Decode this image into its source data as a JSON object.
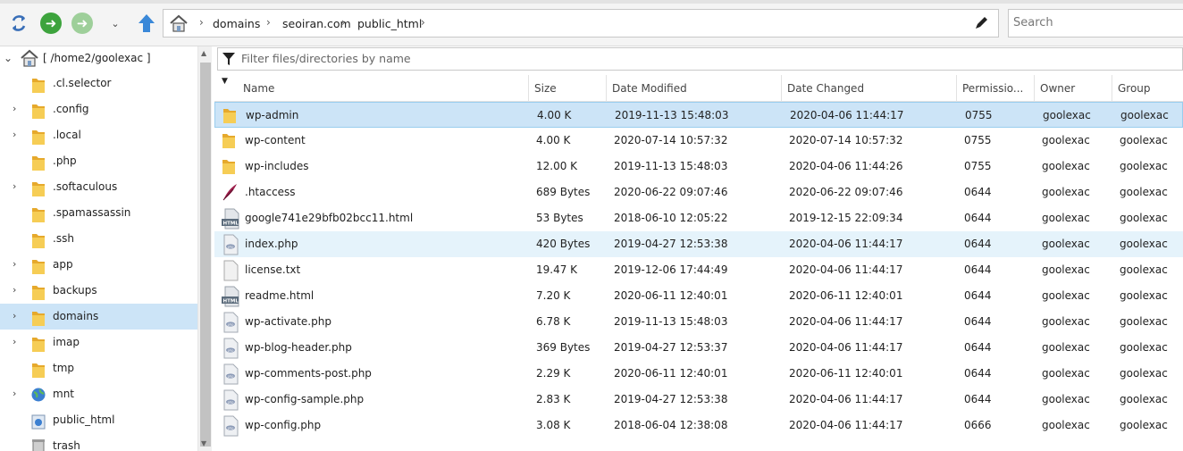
{
  "toolbar": {
    "refresh_icon": "refresh-icon",
    "back_icon": "back-arrow-icon",
    "forward_icon": "forward-arrow-icon",
    "up_icon": "up-arrow-icon"
  },
  "address": {
    "crumbs": [
      "domains",
      "seoiran.com",
      "public_html"
    ]
  },
  "search": {
    "placeholder": "Search"
  },
  "tree": {
    "root_label": "[ /home2/goolexac ]",
    "items": [
      {
        "label": ".cl.selector",
        "expandable": false,
        "icon": "folder-icon"
      },
      {
        "label": ".config",
        "expandable": true,
        "icon": "folder-icon"
      },
      {
        "label": ".local",
        "expandable": true,
        "icon": "folder-icon"
      },
      {
        "label": ".php",
        "expandable": false,
        "icon": "folder-icon"
      },
      {
        "label": ".softaculous",
        "expandable": true,
        "icon": "folder-icon"
      },
      {
        "label": ".spamassassin",
        "expandable": false,
        "icon": "folder-icon"
      },
      {
        "label": ".ssh",
        "expandable": false,
        "icon": "folder-icon"
      },
      {
        "label": "app",
        "expandable": true,
        "icon": "folder-icon"
      },
      {
        "label": "backups",
        "expandable": true,
        "icon": "folder-icon"
      },
      {
        "label": "domains",
        "expandable": true,
        "icon": "folder-icon",
        "selected": true
      },
      {
        "label": "imap",
        "expandable": true,
        "icon": "folder-icon"
      },
      {
        "label": "tmp",
        "expandable": false,
        "icon": "folder-icon"
      },
      {
        "label": "mnt",
        "expandable": true,
        "icon": "globe-icon"
      },
      {
        "label": "public_html",
        "expandable": false,
        "icon": "web-folder-icon"
      },
      {
        "label": "trash",
        "expandable": false,
        "icon": "trash-icon"
      }
    ]
  },
  "filter": {
    "placeholder": "Filter files/directories by name"
  },
  "columns": [
    "Name",
    "Size",
    "Date Modified",
    "Date Changed",
    "Permissio...",
    "Owner",
    "Group"
  ],
  "files": [
    {
      "name": "wp-admin",
      "size": "4.00 K",
      "modified": "2019-11-13 15:48:03",
      "changed": "2020-04-06 11:44:17",
      "perm": "0755",
      "owner": "goolexac",
      "group": "goolexac",
      "icon": "folder-icon"
    },
    {
      "name": "wp-content",
      "size": "4.00 K",
      "modified": "2020-07-14 10:57:32",
      "changed": "2020-07-14 10:57:32",
      "perm": "0755",
      "owner": "goolexac",
      "group": "goolexac",
      "icon": "folder-icon"
    },
    {
      "name": "wp-includes",
      "size": "12.00 K",
      "modified": "2019-11-13 15:48:03",
      "changed": "2020-04-06 11:44:26",
      "perm": "0755",
      "owner": "goolexac",
      "group": "goolexac",
      "icon": "folder-icon"
    },
    {
      "name": ".htaccess",
      "size": "689 Bytes",
      "modified": "2020-06-22 09:07:46",
      "changed": "2020-06-22 09:07:46",
      "perm": "0644",
      "owner": "goolexac",
      "group": "goolexac",
      "icon": "feather-icon"
    },
    {
      "name": "google741e29bfb02bcc11.html",
      "size": "53 Bytes",
      "modified": "2018-06-10 12:05:22",
      "changed": "2019-12-15 22:09:34",
      "perm": "0644",
      "owner": "goolexac",
      "group": "goolexac",
      "icon": "html-file-icon"
    },
    {
      "name": "index.php",
      "size": "420 Bytes",
      "modified": "2019-04-27 12:53:38",
      "changed": "2020-04-06 11:44:17",
      "perm": "0644",
      "owner": "goolexac",
      "group": "goolexac",
      "icon": "php-file-icon"
    },
    {
      "name": "license.txt",
      "size": "19.47 K",
      "modified": "2019-12-06 17:44:49",
      "changed": "2020-04-06 11:44:17",
      "perm": "0644",
      "owner": "goolexac",
      "group": "goolexac",
      "icon": "text-file-icon"
    },
    {
      "name": "readme.html",
      "size": "7.20 K",
      "modified": "2020-06-11 12:40:01",
      "changed": "2020-06-11 12:40:01",
      "perm": "0644",
      "owner": "goolexac",
      "group": "goolexac",
      "icon": "html-file-icon"
    },
    {
      "name": "wp-activate.php",
      "size": "6.78 K",
      "modified": "2019-11-13 15:48:03",
      "changed": "2020-04-06 11:44:17",
      "perm": "0644",
      "owner": "goolexac",
      "group": "goolexac",
      "icon": "php-file-icon"
    },
    {
      "name": "wp-blog-header.php",
      "size": "369 Bytes",
      "modified": "2019-04-27 12:53:37",
      "changed": "2020-04-06 11:44:17",
      "perm": "0644",
      "owner": "goolexac",
      "group": "goolexac",
      "icon": "php-file-icon"
    },
    {
      "name": "wp-comments-post.php",
      "size": "2.29 K",
      "modified": "2020-06-11 12:40:01",
      "changed": "2020-06-11 12:40:01",
      "perm": "0644",
      "owner": "goolexac",
      "group": "goolexac",
      "icon": "php-file-icon"
    },
    {
      "name": "wp-config-sample.php",
      "size": "2.83 K",
      "modified": "2019-04-27 12:53:38",
      "changed": "2020-04-06 11:44:17",
      "perm": "0644",
      "owner": "goolexac",
      "group": "goolexac",
      "icon": "php-file-icon"
    },
    {
      "name": "wp-config.php",
      "size": "3.08 K",
      "modified": "2018-06-04 12:38:08",
      "changed": "2020-04-06 11:44:17",
      "perm": "0666",
      "owner": "goolexac",
      "group": "goolexac",
      "icon": "php-file-icon"
    }
  ],
  "colors": {
    "selection": "#cce4f7",
    "hover": "#e5f3fb",
    "folder": "#f3c046",
    "nav_green": "#3da33d",
    "up_blue": "#3a88d8"
  }
}
